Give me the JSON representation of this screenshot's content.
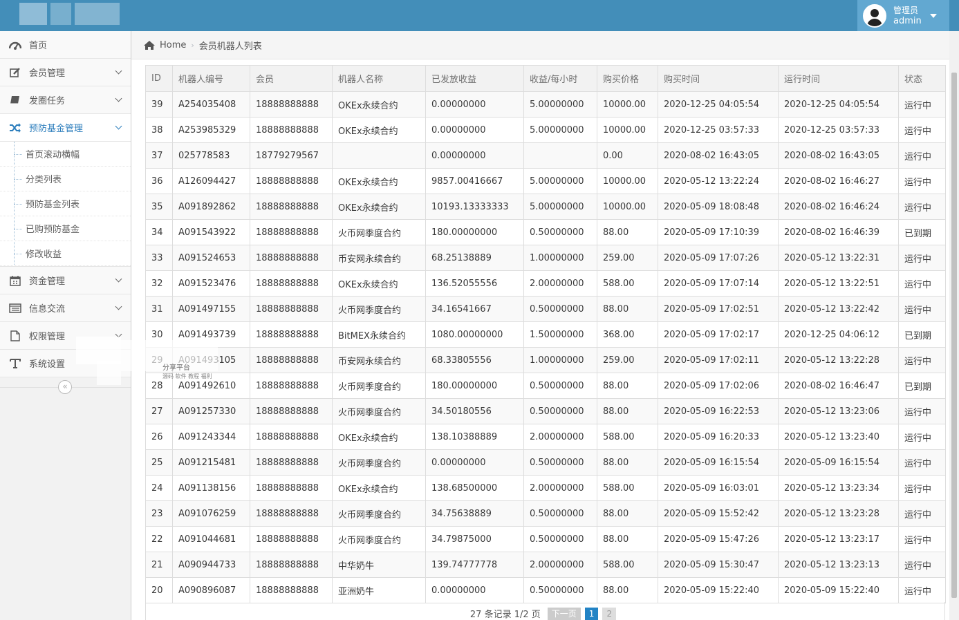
{
  "header": {
    "user_role": "管理员",
    "user_name": "admin"
  },
  "sidebar": {
    "items": [
      {
        "label": "首页",
        "icon": "dashboard-icon"
      },
      {
        "label": "会员管理",
        "icon": "edit-icon"
      },
      {
        "label": "发圈任务",
        "icon": "book-icon"
      },
      {
        "label": "预防基金管理",
        "icon": "shuffle-icon"
      },
      {
        "label": "资金管理",
        "icon": "calendar-icon"
      },
      {
        "label": "信息交流",
        "icon": "list-icon"
      },
      {
        "label": "权限管理",
        "icon": "file-icon"
      },
      {
        "label": "系统设置",
        "icon": "text-icon"
      }
    ],
    "submenu": [
      {
        "label": "首页滚动横幅"
      },
      {
        "label": "分类列表"
      },
      {
        "label": "预防基金列表"
      },
      {
        "label": "已购预防基金"
      },
      {
        "label": "修改收益"
      }
    ],
    "collapse_glyph": "«"
  },
  "breadcrumb": {
    "home": "Home",
    "current": "会员机器人列表"
  },
  "table": {
    "headers": [
      "ID",
      "机器人编号",
      "会员",
      "机器人名称",
      "已发放收益",
      "收益/每小时",
      "购买价格",
      "购买时间",
      "运行时间",
      "状态"
    ],
    "rows": [
      [
        "39",
        "A254035408",
        "18888888888",
        "OKEx永续合约",
        "0.00000000",
        "5.00000000",
        "10000.00",
        "2020-12-25 04:05:54",
        "2020-12-25 04:05:54",
        "运行中"
      ],
      [
        "38",
        "A253985329",
        "18888888888",
        "OKEx永续合约",
        "0.00000000",
        "5.00000000",
        "10000.00",
        "2020-12-25 03:57:33",
        "2020-12-25 03:57:33",
        "运行中"
      ],
      [
        "37",
        "025778583",
        "18779279567",
        "",
        "0.00000000",
        "",
        "0.00",
        "2020-08-02 16:43:05",
        "2020-08-02 16:43:05",
        "运行中"
      ],
      [
        "36",
        "A126094427",
        "18888888888",
        "OKEx永续合约",
        "9857.00416667",
        "5.00000000",
        "10000.00",
        "2020-05-12 13:22:24",
        "2020-08-02 16:46:27",
        "运行中"
      ],
      [
        "35",
        "A091892862",
        "18888888888",
        "OKEx永续合约",
        "10193.13333333",
        "5.00000000",
        "10000.00",
        "2020-05-09 18:08:48",
        "2020-08-02 16:46:24",
        "运行中"
      ],
      [
        "34",
        "A091543922",
        "18888888888",
        "火币网季度合约",
        "180.00000000",
        "0.50000000",
        "88.00",
        "2020-05-09 17:10:39",
        "2020-08-02 16:46:39",
        "已到期"
      ],
      [
        "33",
        "A091524653",
        "18888888888",
        "币安网永续合约",
        "68.25138889",
        "1.00000000",
        "259.00",
        "2020-05-09 17:07:26",
        "2020-05-12 13:22:31",
        "运行中"
      ],
      [
        "32",
        "A091523476",
        "18888888888",
        "OKEx永续合约",
        "136.52055556",
        "2.00000000",
        "588.00",
        "2020-05-09 17:07:14",
        "2020-05-12 13:22:51",
        "运行中"
      ],
      [
        "31",
        "A091497155",
        "18888888888",
        "火币网季度合约",
        "34.16541667",
        "0.50000000",
        "88.00",
        "2020-05-09 17:02:51",
        "2020-05-12 13:22:42",
        "运行中"
      ],
      [
        "30",
        "A091493739",
        "18888888888",
        "BitMEX永续合约",
        "1080.00000000",
        "1.50000000",
        "368.00",
        "2020-05-09 17:02:17",
        "2020-12-25 04:06:12",
        "已到期"
      ],
      [
        "29",
        "A091493105",
        "18888888888",
        "币安网永续合约",
        "68.33805556",
        "1.00000000",
        "259.00",
        "2020-05-09 17:02:11",
        "2020-05-12 13:22:28",
        "运行中"
      ],
      [
        "28",
        "A091492610",
        "18888888888",
        "火币网季度合约",
        "180.00000000",
        "0.50000000",
        "88.00",
        "2020-05-09 17:02:06",
        "2020-08-02 16:46:47",
        "已到期"
      ],
      [
        "27",
        "A091257330",
        "18888888888",
        "火币网季度合约",
        "34.50180556",
        "0.50000000",
        "88.00",
        "2020-05-09 16:22:53",
        "2020-05-12 13:23:06",
        "运行中"
      ],
      [
        "26",
        "A091243344",
        "18888888888",
        "OKEx永续合约",
        "138.10388889",
        "2.00000000",
        "588.00",
        "2020-05-09 16:20:33",
        "2020-05-12 13:23:40",
        "运行中"
      ],
      [
        "25",
        "A091215481",
        "18888888888",
        "火币网季度合约",
        "0.00000000",
        "0.50000000",
        "88.00",
        "2020-05-09 16:15:54",
        "2020-05-09 16:15:54",
        "运行中"
      ],
      [
        "24",
        "A091138156",
        "18888888888",
        "OKEx永续合约",
        "138.68500000",
        "2.00000000",
        "588.00",
        "2020-05-09 16:03:01",
        "2020-05-12 13:23:34",
        "运行中"
      ],
      [
        "23",
        "A091076259",
        "18888888888",
        "火币网季度合约",
        "34.75638889",
        "0.50000000",
        "88.00",
        "2020-05-09 15:52:42",
        "2020-05-12 13:23:28",
        "运行中"
      ],
      [
        "22",
        "A091044681",
        "18888888888",
        "火币网季度合约",
        "34.79875000",
        "0.50000000",
        "88.00",
        "2020-05-09 15:47:26",
        "2020-05-12 13:23:17",
        "运行中"
      ],
      [
        "21",
        "A090944733",
        "18888888888",
        "中华奶牛",
        "139.74777778",
        "2.00000000",
        "588.00",
        "2020-05-09 15:30:47",
        "2020-05-12 13:23:13",
        "运行中"
      ],
      [
        "20",
        "A090896087",
        "18888888888",
        "亚洲奶牛",
        "0.00000000",
        "0.50000000",
        "88.00",
        "2020-05-09 15:22:40",
        "2020-05-09 15:22:40",
        "运行中"
      ]
    ]
  },
  "pagination": {
    "info": "27 条记录 1/2 页",
    "next_label": "下一页",
    "current_page": "1",
    "other_page": "2"
  },
  "watermark": {
    "text": "分享平台",
    "subtext": "源码 软件 教程 福利"
  },
  "colors": {
    "header_bg": "#438eb9",
    "user_box_bg": "#62a8d1",
    "active_menu": "#2b7dbc",
    "page_current": "#2283c5"
  }
}
